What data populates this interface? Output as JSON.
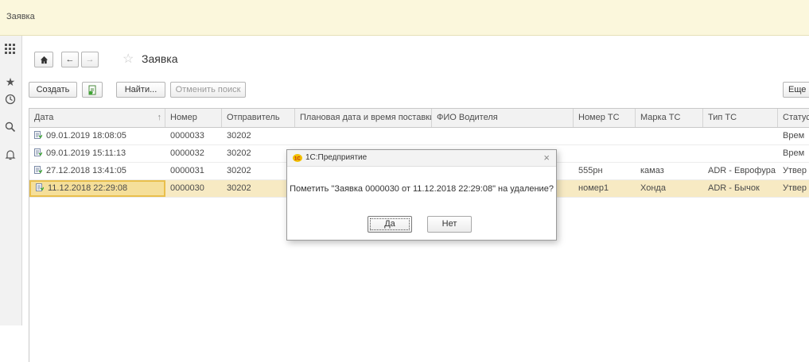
{
  "window": {
    "title": "Заявка"
  },
  "form": {
    "title": "Заявка",
    "nav": {
      "home_icon": "home-icon",
      "back_icon": "arrow-left-icon",
      "forward_icon": "arrow-right-icon",
      "favorite_icon": "star-icon"
    }
  },
  "toolbar": {
    "create_label": "Создать",
    "find_label": "Найти...",
    "cancel_search_label": "Отменить поиск",
    "more_label": "Еще"
  },
  "sidebar_icons": [
    "apps-grid-icon",
    "star-icon",
    "history-icon",
    "search-icon",
    "bell-icon"
  ],
  "table": {
    "columns": [
      "Дата",
      "Номер",
      "Отправитель",
      "Плановая дата и время поставки",
      "ФИО Водителя",
      "Номер ТС",
      "Марка ТС",
      "Тип ТС",
      "Статус"
    ],
    "sort_indicator": "↑",
    "rows": [
      {
        "date": "09.01.2019 18:08:05",
        "number": "0000033",
        "sender": "30202",
        "planned": "",
        "driver": "",
        "vehicle_no": "",
        "brand": "",
        "type": "",
        "status": "Врем"
      },
      {
        "date": "09.01.2019 15:11:13",
        "number": "0000032",
        "sender": "30202",
        "planned": "",
        "driver": "",
        "vehicle_no": "",
        "brand": "",
        "type": "",
        "status": "Врем"
      },
      {
        "date": "27.12.2018 13:41:05",
        "number": "0000031",
        "sender": "30202",
        "planned": "",
        "driver": "",
        "vehicle_no": "555рн",
        "brand": "камаз",
        "type": "ADR - Еврофура",
        "status": "Утвер"
      },
      {
        "date": "11.12.2018 22:29:08",
        "number": "0000030",
        "sender": "30202",
        "planned": "",
        "driver": "",
        "vehicle_no": "номер1",
        "brand": "Хонда",
        "type": "ADR - Бычок",
        "status": "Утвер"
      }
    ]
  },
  "dialog": {
    "title": "1С:Предприятие",
    "message": "Пометить \"Заявка 0000030 от 11.12.2018 22:29:08\" на удаление?",
    "yes_label": "Да",
    "no_label": "Нет",
    "close_label": "×"
  },
  "colors": {
    "topbar": "#fbf7dc",
    "selected_row": "#f7eac3",
    "selected_cell_border": "#e9bf4c",
    "logo": "#f2c200"
  }
}
